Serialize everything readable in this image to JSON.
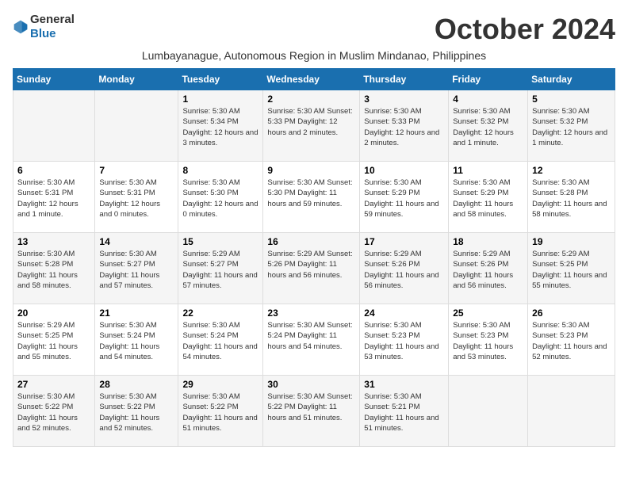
{
  "header": {
    "logo_general": "General",
    "logo_blue": "Blue",
    "month_title": "October 2024",
    "subtitle": "Lumbayanague, Autonomous Region in Muslim Mindanao, Philippines"
  },
  "weekdays": [
    "Sunday",
    "Monday",
    "Tuesday",
    "Wednesday",
    "Thursday",
    "Friday",
    "Saturday"
  ],
  "weeks": [
    [
      {
        "day": "",
        "info": ""
      },
      {
        "day": "",
        "info": ""
      },
      {
        "day": "1",
        "info": "Sunrise: 5:30 AM\nSunset: 5:34 PM\nDaylight: 12 hours\nand 3 minutes."
      },
      {
        "day": "2",
        "info": "Sunrise: 5:30 AM\nSunset: 5:33 PM\nDaylight: 12 hours\nand 2 minutes."
      },
      {
        "day": "3",
        "info": "Sunrise: 5:30 AM\nSunset: 5:33 PM\nDaylight: 12 hours\nand 2 minutes."
      },
      {
        "day": "4",
        "info": "Sunrise: 5:30 AM\nSunset: 5:32 PM\nDaylight: 12 hours\nand 1 minute."
      },
      {
        "day": "5",
        "info": "Sunrise: 5:30 AM\nSunset: 5:32 PM\nDaylight: 12 hours\nand 1 minute."
      }
    ],
    [
      {
        "day": "6",
        "info": "Sunrise: 5:30 AM\nSunset: 5:31 PM\nDaylight: 12 hours\nand 1 minute."
      },
      {
        "day": "7",
        "info": "Sunrise: 5:30 AM\nSunset: 5:31 PM\nDaylight: 12 hours\nand 0 minutes."
      },
      {
        "day": "8",
        "info": "Sunrise: 5:30 AM\nSunset: 5:30 PM\nDaylight: 12 hours\nand 0 minutes."
      },
      {
        "day": "9",
        "info": "Sunrise: 5:30 AM\nSunset: 5:30 PM\nDaylight: 11 hours\nand 59 minutes."
      },
      {
        "day": "10",
        "info": "Sunrise: 5:30 AM\nSunset: 5:29 PM\nDaylight: 11 hours\nand 59 minutes."
      },
      {
        "day": "11",
        "info": "Sunrise: 5:30 AM\nSunset: 5:29 PM\nDaylight: 11 hours\nand 58 minutes."
      },
      {
        "day": "12",
        "info": "Sunrise: 5:30 AM\nSunset: 5:28 PM\nDaylight: 11 hours\nand 58 minutes."
      }
    ],
    [
      {
        "day": "13",
        "info": "Sunrise: 5:30 AM\nSunset: 5:28 PM\nDaylight: 11 hours\nand 58 minutes."
      },
      {
        "day": "14",
        "info": "Sunrise: 5:30 AM\nSunset: 5:27 PM\nDaylight: 11 hours\nand 57 minutes."
      },
      {
        "day": "15",
        "info": "Sunrise: 5:29 AM\nSunset: 5:27 PM\nDaylight: 11 hours\nand 57 minutes."
      },
      {
        "day": "16",
        "info": "Sunrise: 5:29 AM\nSunset: 5:26 PM\nDaylight: 11 hours\nand 56 minutes."
      },
      {
        "day": "17",
        "info": "Sunrise: 5:29 AM\nSunset: 5:26 PM\nDaylight: 11 hours\nand 56 minutes."
      },
      {
        "day": "18",
        "info": "Sunrise: 5:29 AM\nSunset: 5:26 PM\nDaylight: 11 hours\nand 56 minutes."
      },
      {
        "day": "19",
        "info": "Sunrise: 5:29 AM\nSunset: 5:25 PM\nDaylight: 11 hours\nand 55 minutes."
      }
    ],
    [
      {
        "day": "20",
        "info": "Sunrise: 5:29 AM\nSunset: 5:25 PM\nDaylight: 11 hours\nand 55 minutes."
      },
      {
        "day": "21",
        "info": "Sunrise: 5:30 AM\nSunset: 5:24 PM\nDaylight: 11 hours\nand 54 minutes."
      },
      {
        "day": "22",
        "info": "Sunrise: 5:30 AM\nSunset: 5:24 PM\nDaylight: 11 hours\nand 54 minutes."
      },
      {
        "day": "23",
        "info": "Sunrise: 5:30 AM\nSunset: 5:24 PM\nDaylight: 11 hours\nand 54 minutes."
      },
      {
        "day": "24",
        "info": "Sunrise: 5:30 AM\nSunset: 5:23 PM\nDaylight: 11 hours\nand 53 minutes."
      },
      {
        "day": "25",
        "info": "Sunrise: 5:30 AM\nSunset: 5:23 PM\nDaylight: 11 hours\nand 53 minutes."
      },
      {
        "day": "26",
        "info": "Sunrise: 5:30 AM\nSunset: 5:23 PM\nDaylight: 11 hours\nand 52 minutes."
      }
    ],
    [
      {
        "day": "27",
        "info": "Sunrise: 5:30 AM\nSunset: 5:22 PM\nDaylight: 11 hours\nand 52 minutes."
      },
      {
        "day": "28",
        "info": "Sunrise: 5:30 AM\nSunset: 5:22 PM\nDaylight: 11 hours\nand 52 minutes."
      },
      {
        "day": "29",
        "info": "Sunrise: 5:30 AM\nSunset: 5:22 PM\nDaylight: 11 hours\nand 51 minutes."
      },
      {
        "day": "30",
        "info": "Sunrise: 5:30 AM\nSunset: 5:22 PM\nDaylight: 11 hours\nand 51 minutes."
      },
      {
        "day": "31",
        "info": "Sunrise: 5:30 AM\nSunset: 5:21 PM\nDaylight: 11 hours\nand 51 minutes."
      },
      {
        "day": "",
        "info": ""
      },
      {
        "day": "",
        "info": ""
      }
    ]
  ]
}
